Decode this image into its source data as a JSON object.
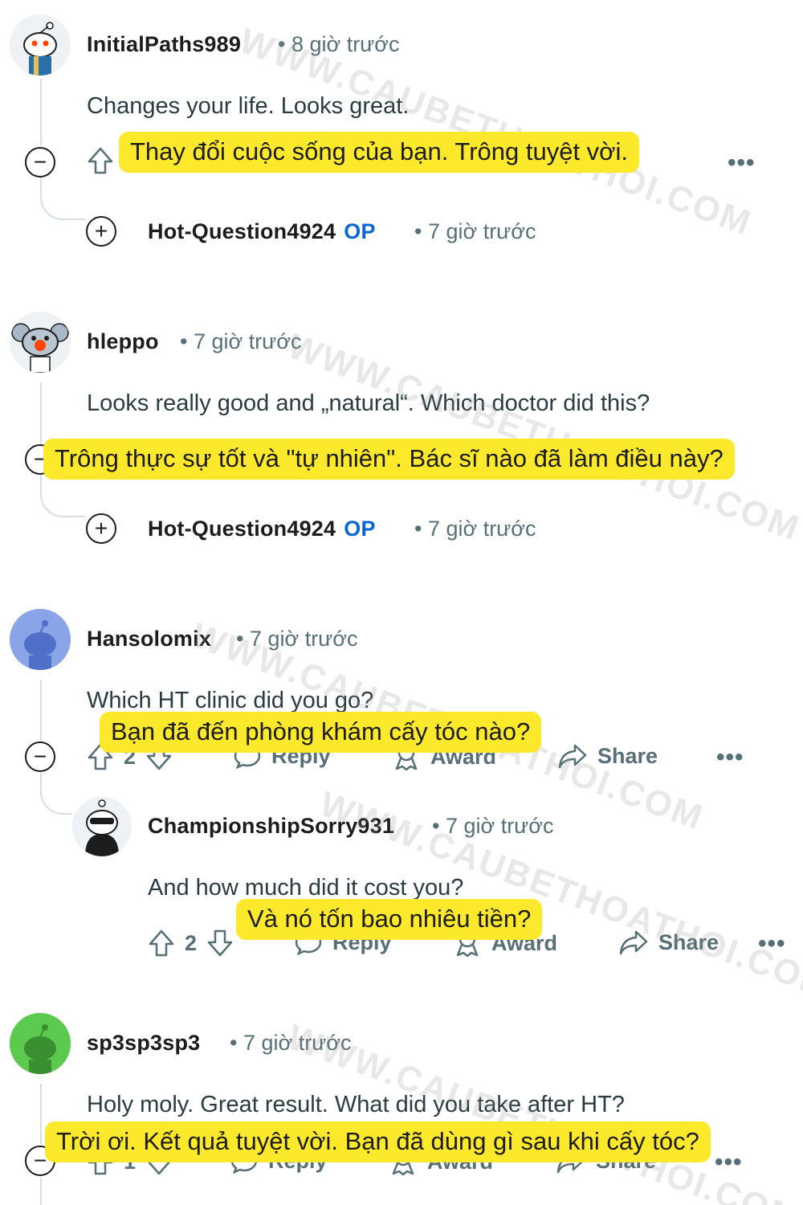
{
  "comments": [
    {
      "username": "InitialPaths989",
      "time": "• 8 giờ trước",
      "text": "Changes your life. Looks great.",
      "translation": "Thay đổi cuộc sống của bạn. Trông tuyệt vời.",
      "reply": {
        "username": "Hot-Question4924",
        "op": "OP",
        "time": "• 7 giờ trước"
      }
    },
    {
      "username": "hleppo",
      "time": "• 7 giờ trước",
      "text": "Looks really good and „natural“. Which doctor did this?",
      "translation": "Trông thực sự tốt và \"tự nhiên\". Bác sĩ nào đã làm điều này?",
      "reply": {
        "username": "Hot-Question4924",
        "op": "OP",
        "time": "• 7 giờ trước"
      }
    },
    {
      "username": "Hansolomix",
      "time": "• 7 giờ trước",
      "text": "Which HT clinic did you go?",
      "translation": "Bạn đã đến phòng khám cấy tóc nào?",
      "votes": "2",
      "reply_label": "Reply",
      "award_label": "Award",
      "share_label": "Share",
      "child": {
        "username": "ChampionshipSorry931",
        "time": "• 7 giờ trước",
        "text": "And how much did it cost you?",
        "translation": "Và nó tốn bao nhiêu tiền?",
        "votes": "2",
        "reply_label": "Reply",
        "award_label": "Award",
        "share_label": "Share"
      }
    },
    {
      "username": "sp3sp3sp3",
      "time": "• 7 giờ trước",
      "text": "Holy moly. Great result. What did you take after HT?",
      "translation": "Trời ơi. Kết quả tuyệt vời. Bạn đã dùng gì sau khi cấy tóc?",
      "votes": "1",
      "reply_label": "Reply",
      "award_label": "Award",
      "share_label": "Share"
    }
  ],
  "watermark": "WWW.CAUBETHOATHOI.COM",
  "more_label": "•••",
  "collapse_symbol": "−",
  "expand_symbol": "+",
  "colors": {
    "highlight": "#fde92b",
    "op": "#0a66d6",
    "meta": "#576f76",
    "avatar_blue": "#8aa4e8",
    "avatar_green": "#5cc94f"
  }
}
